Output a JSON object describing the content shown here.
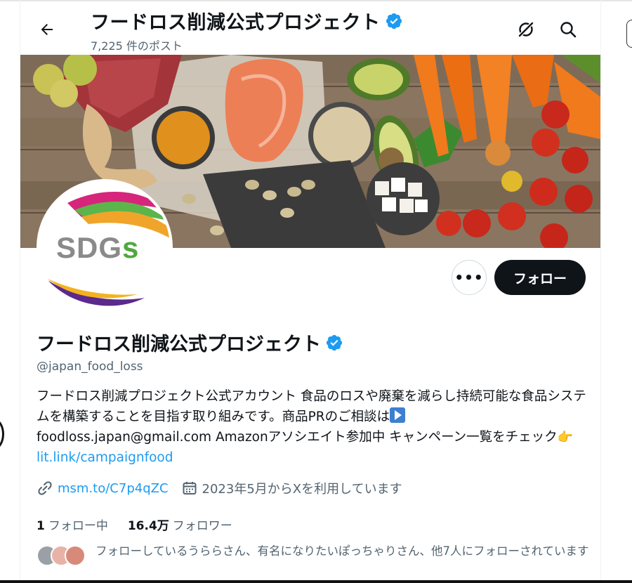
{
  "header": {
    "title": "フードロス削減公式プロジェクト",
    "post_count": "7,225 件のポスト",
    "back_icon": "arrow-left-icon",
    "icons": [
      "grok-icon",
      "search-icon"
    ]
  },
  "profile": {
    "avatar_text_main": "SDG",
    "avatar_text_accent": "s",
    "display_name": "フードロス削減公式プロジェクト",
    "handle": "@japan_food_loss",
    "more_label": "•••",
    "follow_label": "フォロー",
    "bio_text_1": "フードロス削減プロジェクト公式アカウント 食品のロスや廃棄を減らし持続可能な食品システムを構築することを目指す取り組みです。商品PRのご相談は",
    "bio_text_2": "foodloss.japan@gmail.com Amazonアソシエイト参加中 キャンペーン一覧をチェック",
    "bio_emoji_hand": "👉",
    "bio_link": "lit.link/campaignfood",
    "website": "msm.to/C7p4qZC",
    "joined": "2023年5月からXを利用しています",
    "following_count": "1",
    "following_label": "フォロー中",
    "followers_count": "16.4万",
    "followers_label": "フォロワー",
    "known_followers_text": "フォローしているうららさん、有名になりたいぽっちゃりさん、他7人にフォローされています"
  },
  "colors": {
    "accent": "#1d9bf0",
    "text_primary": "#0f1419",
    "text_secondary": "#536471",
    "verified": "#1d9bf0"
  }
}
